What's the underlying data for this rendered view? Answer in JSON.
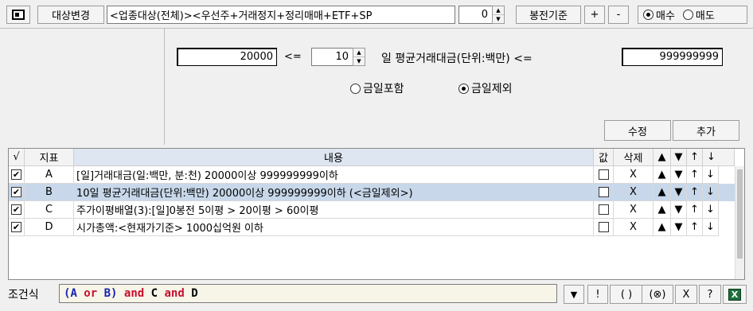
{
  "toolbar": {
    "industry_change_label": "대상변경",
    "filter_text": "<업종대상(전체)><우선주+거래정지+정리매매+ETF+SP",
    "spin_value": "0",
    "candle_basis_label": "봉전기준",
    "plus_label": "+",
    "minus_label": "-",
    "buy_label": "매수",
    "sell_label": "매도",
    "buy_selected": true
  },
  "condition": {
    "min_value": "20000",
    "lte1": "<=",
    "days_value": "10",
    "desc_label": "일 평균거래대금(단위:백만) <=",
    "max_value": "999999999",
    "include_today_label": "금일포함",
    "exclude_today_label": "금일제외",
    "exclude_selected": true,
    "edit_label": "수정",
    "add_label": "추가"
  },
  "table": {
    "headers": {
      "check": "√",
      "indicator": "지표",
      "content": "내용",
      "value": "값",
      "delete": "삭제",
      "up_fill": "▲",
      "down_fill": "▼",
      "up_arrow": "↑",
      "down_arrow": "↓"
    },
    "rows": [
      {
        "checked": "✔",
        "code": "A",
        "content": "[일]거래대금(일:백만, 분:천) 20000이상 999999999이하",
        "delete": "X",
        "up_fill": "▲",
        "down_fill": "▼",
        "up_arrow": "↑",
        "down_arrow": "↓"
      },
      {
        "checked": "✔",
        "code": "B",
        "content": "10일 평균거래대금(단위:백만) 20000이상 999999999이하 (<금일제외>)",
        "delete": "X",
        "up_fill": "▲",
        "down_fill": "▼",
        "up_arrow": "↑",
        "down_arrow": "↓"
      },
      {
        "checked": "✔",
        "code": "C",
        "content": "주가이평배열(3):[일]0봉전 5이평 > 20이평 > 60이평",
        "delete": "X",
        "up_fill": "▲",
        "down_fill": "▼",
        "up_arrow": "↑",
        "down_arrow": "↓"
      },
      {
        "checked": "✔",
        "code": "D",
        "content": "시가총액:<현재가기준> 1000십억원 이하",
        "delete": "X",
        "up_fill": "▲",
        "down_fill": "▼",
        "up_arrow": "↑",
        "down_arrow": "↓"
      }
    ]
  },
  "formula": {
    "label": "조건식",
    "tokens": {
      "open": "(",
      "a": "A",
      "or": " or ",
      "b": "B",
      "close": ")",
      "and1": " and ",
      "c": "C",
      "and2": " and ",
      "d": "D"
    },
    "buttons": {
      "dropdown": "▼",
      "not": "!",
      "paren": "( )",
      "xor": "(⊗)",
      "delete": "X",
      "help": "?"
    }
  },
  "colors": {
    "variable": "#1a23b0",
    "operator": "#c8102e",
    "selected_row": "#c8d8ea",
    "header_highlight": "#dde6f1",
    "formula_bg": "#f6f5e8"
  },
  "icons": {
    "window": "window-icon",
    "excel": "excel-icon"
  }
}
